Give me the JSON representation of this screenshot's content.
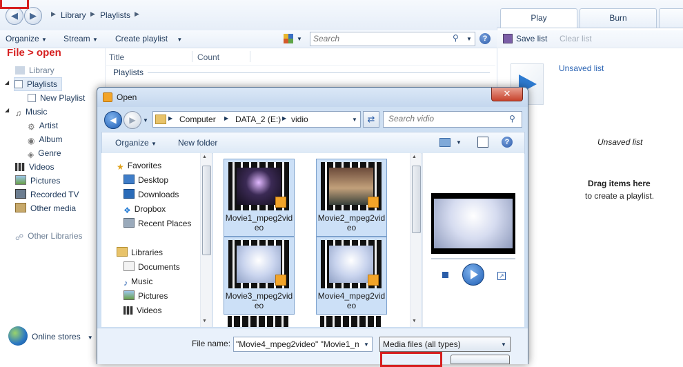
{
  "annotation": {
    "text": "File > open",
    "color": "#d62020"
  },
  "breadcrumb": [
    "Library",
    "Playlists"
  ],
  "toolbar": {
    "organize": "Organize",
    "stream": "Stream",
    "create_playlist": "Create playlist",
    "search_placeholder": "Search"
  },
  "columns": {
    "title": "Title",
    "count": "Count",
    "group": "Playlists"
  },
  "nav": {
    "library": "Library",
    "playlists": "Playlists",
    "new_playlist": "New Playlist",
    "music": "Music",
    "artist": "Artist",
    "album": "Album",
    "genre": "Genre",
    "videos": "Videos",
    "pictures": "Pictures",
    "recorded_tv": "Recorded TV",
    "other_media": "Other media",
    "other_libraries": "Other Libraries",
    "online_stores": "Online stores"
  },
  "list_pane": {
    "tabs": [
      "Play",
      "Burn"
    ],
    "save_list": "Save list",
    "clear_list": "Clear list",
    "unsaved_list_link": "Unsaved list",
    "unsaved_list_title": "Unsaved list",
    "drag_title": "Drag items here",
    "drag_sub": "to create a playlist."
  },
  "dialog": {
    "title": "Open",
    "address": [
      "Computer",
      "DATA_2 (E:)",
      "vidio"
    ],
    "search_placeholder": "Search vidio",
    "organize": "Organize",
    "new_folder": "New folder",
    "tree": {
      "favorites": "Favorites",
      "desktop": "Desktop",
      "downloads": "Downloads",
      "dropbox": "Dropbox",
      "recent_places": "Recent Places",
      "libraries": "Libraries",
      "documents": "Documents",
      "music": "Music",
      "pictures": "Pictures",
      "videos": "Videos"
    },
    "files": [
      {
        "name": "Movie1_mpeg2video"
      },
      {
        "name": "Movie2_mpeg2video"
      },
      {
        "name": "Movie3_mpeg2video"
      },
      {
        "name": "Movie4_mpeg2video"
      }
    ],
    "file_name_label": "File name:",
    "file_name_value": "\"Movie4_mpeg2video\" \"Movie1_m",
    "file_type": "Media files (all types)"
  }
}
